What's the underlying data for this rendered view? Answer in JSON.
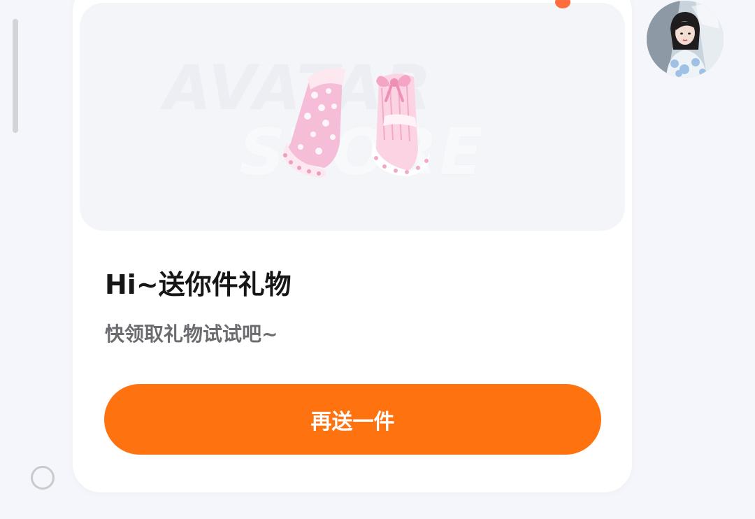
{
  "chat": {
    "gift_card": {
      "image": {
        "watermark_line1": "AVATAR",
        "watermark_line2": "STORE",
        "item": "pink-polka-dot-ruffle-socks-icon"
      },
      "title": "Hi~送你件礼物",
      "subtitle": "快领取礼物试试吧~",
      "button_label": "再送一件"
    },
    "sender": {
      "avatar": "woman-portrait-avatar"
    }
  },
  "colors": {
    "background": "#f4f6fb",
    "card": "#ffffff",
    "accent": "#ff7210",
    "title_text": "#161616",
    "subtitle_text": "#6b6b70",
    "notification_dot": "#ff6d3c"
  }
}
